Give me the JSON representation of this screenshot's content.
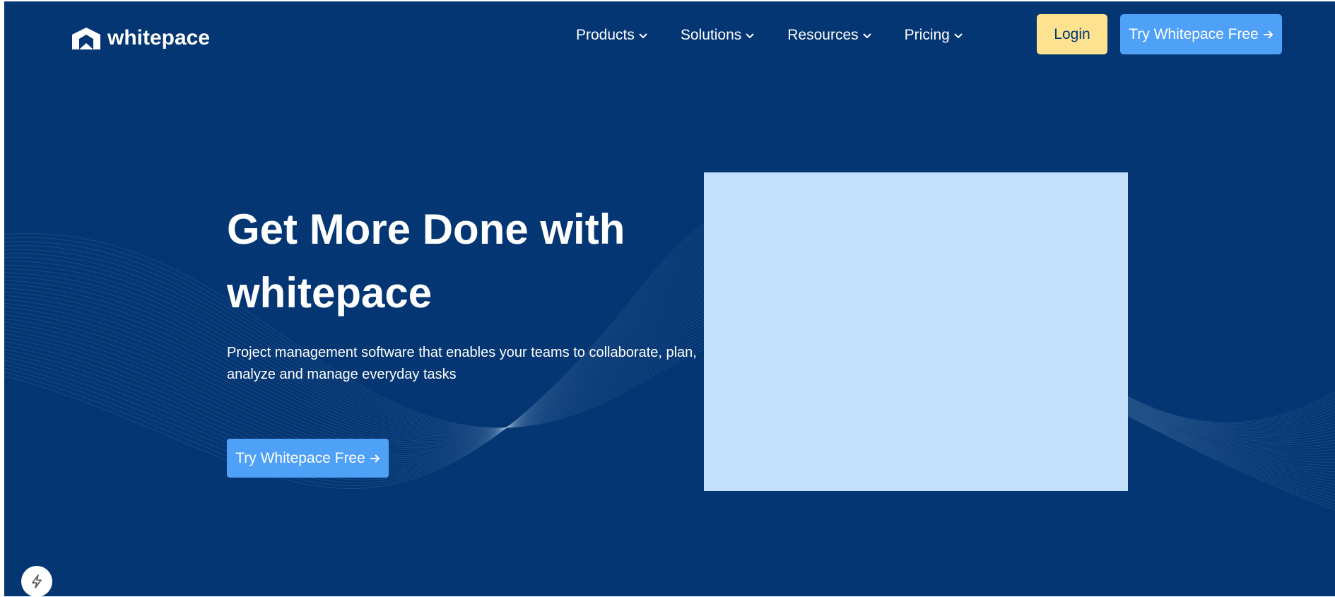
{
  "brand": {
    "name": "whitepace",
    "logo_icon": "whitepace-chevron-logo"
  },
  "nav": {
    "items": [
      {
        "label": "Products",
        "icon": "chevron-down-icon"
      },
      {
        "label": "Solutions",
        "icon": "chevron-down-icon"
      },
      {
        "label": "Resources",
        "icon": "chevron-down-icon"
      },
      {
        "label": "Pricing",
        "icon": "chevron-down-icon"
      }
    ],
    "login_label": "Login",
    "cta_label": "Try Whitepace Free",
    "cta_icon": "arrow-right-icon"
  },
  "hero": {
    "title": "Get More Done with whitepace",
    "subtitle": "Project management software that enables your teams to collaborate, plan, analyze and manage everyday tasks",
    "cta_label": "Try Whitepace Free",
    "cta_icon": "arrow-right-icon"
  },
  "widget": {
    "icon": "lightning-bolt-icon"
  },
  "colors": {
    "background": "#043673",
    "login_button": "#fde28f",
    "cta_button": "#4fa0f7",
    "hero_image_placeholder": "#c4dffb",
    "text": "#ffffff"
  }
}
